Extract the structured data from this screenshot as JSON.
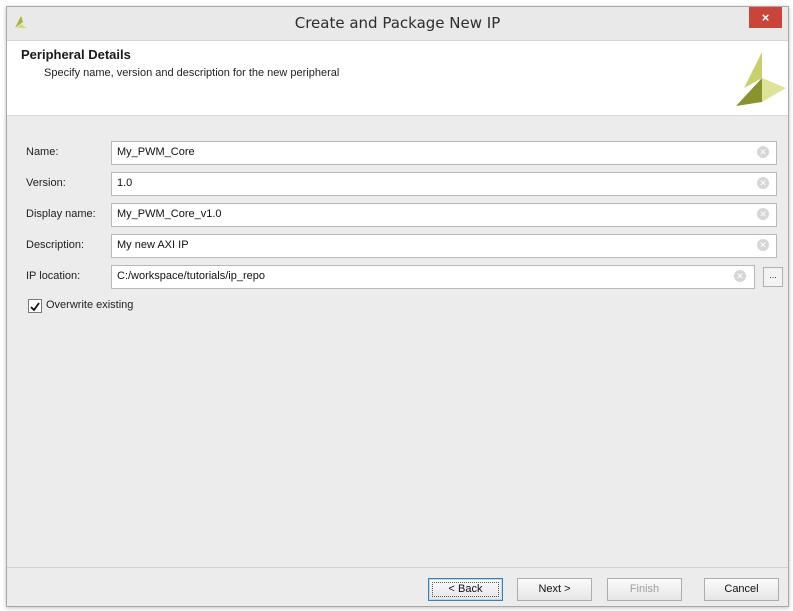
{
  "window": {
    "title": "Create and Package New IP",
    "close_label": "×"
  },
  "header": {
    "title": "Peripheral Details",
    "subtitle": "Specify name, version and description for the new peripheral",
    "logo_icon": "xilinx-logo-icon"
  },
  "form": {
    "fields": [
      {
        "label": "Name:",
        "value": "My_PWM_Core"
      },
      {
        "label": "Version:",
        "value": "1.0"
      },
      {
        "label": "Display name:",
        "value": "My_PWM_Core_v1.0"
      },
      {
        "label": "Description:",
        "value": "My new AXI IP"
      },
      {
        "label": "IP location:",
        "value": "C:/workspace/tutorials/ip_repo"
      }
    ],
    "browse_label": "...",
    "overwrite": {
      "label": "Overwrite existing",
      "checked": true
    }
  },
  "footer": {
    "back_label": "< Back",
    "next_label": "Next >",
    "finish_label": "Finish",
    "cancel_label": "Cancel"
  },
  "colors": {
    "close": "#c9453a",
    "logo_light": "#c9cf6a",
    "logo_dark": "#8a922e"
  }
}
